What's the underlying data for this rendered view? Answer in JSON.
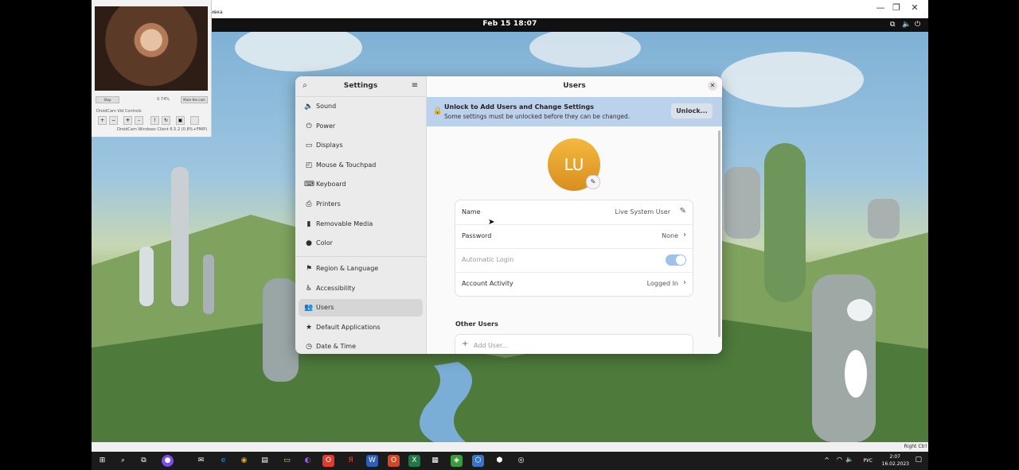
{
  "host_window": {
    "title_fragment": "ивка",
    "buttons": [
      "—",
      "❐",
      "✕"
    ]
  },
  "webcam": {
    "btn_left": "Stop",
    "zoom": "0.74%",
    "btn_right": "Mute the cam",
    "controls_label": "DroidCam Vid Controls",
    "footer": "DroidCam Windows Client 6.5.2 (0.8%+FMIP)"
  },
  "gnome": {
    "clock": "Feb 15  18:07",
    "icons": [
      "network-icon",
      "volume-icon",
      "power-icon"
    ]
  },
  "settings": {
    "sidebar_title": "Settings",
    "nav": [
      {
        "label": "Sound",
        "icon": "🔈"
      },
      {
        "label": "Power",
        "icon": "⏻"
      },
      {
        "label": "Displays",
        "icon": "▭"
      },
      {
        "label": "Mouse & Touchpad",
        "icon": "◰"
      },
      {
        "label": "Keyboard",
        "icon": "⌨"
      },
      {
        "label": "Printers",
        "icon": "⎙"
      },
      {
        "label": "Removable Media",
        "icon": "▮"
      },
      {
        "label": "Color",
        "icon": "●"
      },
      {
        "label": "Region & Language",
        "icon": "⚑"
      },
      {
        "label": "Accessibility",
        "icon": "♿"
      },
      {
        "label": "Users",
        "icon": "👥"
      },
      {
        "label": "Default Applications",
        "icon": "★"
      },
      {
        "label": "Date & Time",
        "icon": "◷"
      }
    ],
    "main_title": "Users",
    "banner_title": "Unlock to Add Users and Change Settings",
    "banner_sub": "Some settings must be unlocked before they can be changed.",
    "unlock_label": "Unlock...",
    "avatar_initials": "LU",
    "rows": {
      "name": {
        "label": "Name",
        "value": "Live System User"
      },
      "password": {
        "label": "Password",
        "value": "None"
      },
      "autologin": {
        "label": "Automatic Login",
        "enabled": true
      },
      "activity": {
        "label": "Account Activity",
        "value": "Logged In"
      }
    },
    "other_users_label": "Other Users",
    "add_user_label": "Add User..."
  },
  "vbox_status": {
    "host_key": "Right Ctrl"
  },
  "taskbar": {
    "tray": {
      "lang": "РУС",
      "time": "2:07",
      "date": "16.02.2023"
    }
  }
}
